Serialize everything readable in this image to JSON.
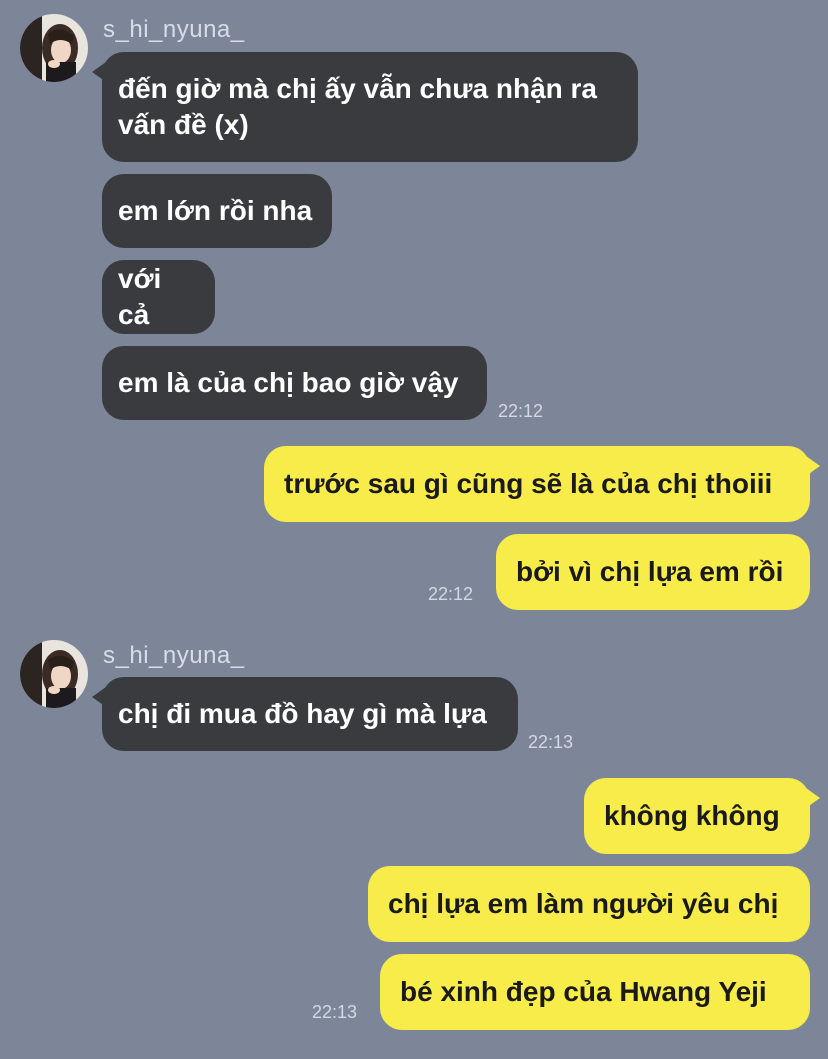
{
  "chat": {
    "group1": {
      "sender": "s_hi_nyuna_",
      "messages": [
        "đến giờ mà chị ấy vẫn chưa nhận ra\nvấn đề (x)",
        "em lớn rồi nha",
        "với cả",
        "em là của chị bao giờ vậy"
      ],
      "time": "22:12"
    },
    "group2": {
      "messages": [
        "trước sau gì cũng sẽ là của chị thoiii",
        "bởi vì chị lựa em rồi"
      ],
      "time": "22:12"
    },
    "group3": {
      "sender": "s_hi_nyuna_",
      "messages": [
        "chị đi mua đồ hay gì mà lựa"
      ],
      "time": "22:13"
    },
    "group4": {
      "messages": [
        "không không",
        "chị lựa em làm người yêu chị",
        "bé xinh đẹp của Hwang Yeji"
      ],
      "time": "22:13"
    }
  },
  "colors": {
    "background": "#7d8699",
    "incoming_bubble": "#3a3b3f",
    "outgoing_bubble": "#f8ec4a"
  },
  "icons": {
    "avatar": "profile-photo"
  }
}
